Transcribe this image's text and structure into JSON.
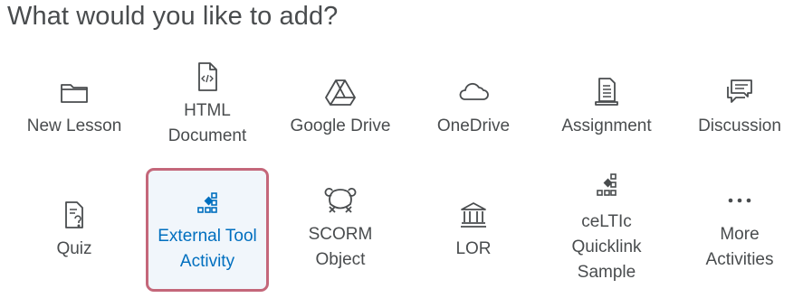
{
  "heading": "What would you like to add?",
  "colors": {
    "text": "#494c4e",
    "accent_blue": "#006fbf",
    "selected_border": "#c4677a",
    "selected_bg": "#f1f6fb"
  },
  "options": [
    {
      "label": "New Lesson",
      "icon": "folder-icon"
    },
    {
      "label": "HTML\nDocument",
      "icon": "html-file-icon"
    },
    {
      "label": "Google Drive",
      "icon": "google-drive-icon"
    },
    {
      "label": "OneDrive",
      "icon": "cloud-icon"
    },
    {
      "label": "Assignment",
      "icon": "assignment-icon"
    },
    {
      "label": "Discussion",
      "icon": "discussion-icon"
    },
    {
      "label": "Quiz",
      "icon": "quiz-icon"
    },
    {
      "label": "External Tool\nActivity",
      "icon": "external-tool-icon",
      "selected": true
    },
    {
      "label": "SCORM\nObject",
      "icon": "scorm-icon"
    },
    {
      "label": "LOR",
      "icon": "library-icon"
    },
    {
      "label": "ceLTIc\nQuicklink\nSample",
      "icon": "external-tool-icon"
    },
    {
      "label": "More\nActivities",
      "icon": "more-icon"
    }
  ]
}
